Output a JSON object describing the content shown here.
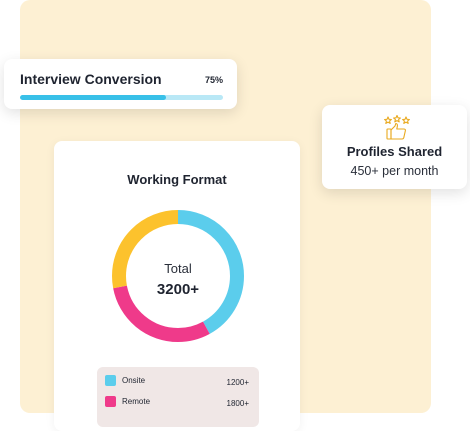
{
  "interview": {
    "title": "Interview Conversion",
    "percent_label": "75%",
    "progress": 0.72,
    "fill_color": "#38c0e8",
    "track_color": "#b9e8f6"
  },
  "profiles": {
    "icon": "thumbs-up-stars-icon",
    "title": "Profiles Shared",
    "subtitle": "450+ per month"
  },
  "format": {
    "title": "Working Format",
    "center_label": "Total",
    "center_value": "3200+",
    "legend": [
      {
        "label": "Onsite",
        "value": "1200+",
        "color": "#5bcdec"
      },
      {
        "label": "Remote",
        "value": "1800+",
        "color": "#ef3a8a"
      }
    ]
  },
  "chart_data": {
    "type": "pie",
    "variant": "donut",
    "title": "Working Format",
    "center_text": "Total 3200+",
    "slices": [
      {
        "color": "#5bcdec",
        "fraction": 0.42
      },
      {
        "color": "#ef3a8a",
        "fraction": 0.3
      },
      {
        "color": "#fcc22d",
        "fraction": 0.28
      }
    ]
  }
}
